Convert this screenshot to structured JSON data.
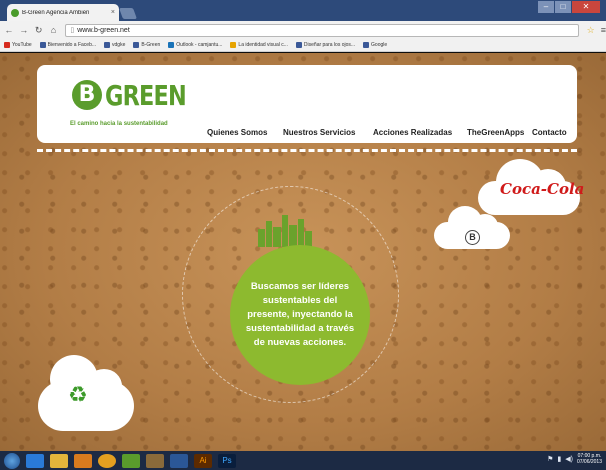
{
  "browser": {
    "tab_title": "B-Green Agencia Ambien",
    "tab_close": "×",
    "address": "www.b-green.net",
    "bookmarks": [
      {
        "label": "YouTube",
        "color": "#d62b1e"
      },
      {
        "label": "Bienvenido a Faceb...",
        "color": "#3b5998"
      },
      {
        "label": "vdgke",
        "color": "#3b5998"
      },
      {
        "label": "B-Green",
        "color": "#3b5998"
      },
      {
        "label": "Outlook - camjantu...",
        "color": "#1a73b8"
      },
      {
        "label": "La identidad visual c...",
        "color": "#e6a300"
      },
      {
        "label": "Diseñar para los ojos...",
        "color": "#3b5998"
      },
      {
        "label": "Google",
        "color": "#3b5998"
      }
    ]
  },
  "site": {
    "logo_letter": "B",
    "logo_word": "GREEN",
    "tagline": "El camino hacia la sustentabilidad",
    "nav": [
      "Quienes Somos",
      "Nuestros Servicios",
      "Acciones Realizadas",
      "TheGreenApps",
      "Contacto"
    ],
    "partner_logo": "Coca-Cola",
    "b_mark": "B",
    "mission": "Buscamos ser líderes sustentables del presente, inyectando la sustentabilidad a través de nuevas acciones.",
    "recycle_symbol": "♻"
  },
  "colors": {
    "brand_green": "#5a9c2c",
    "circle_green": "#8dba2f",
    "coke_red": "#d01a1a"
  },
  "taskbar": {
    "icons": [
      "start-icon",
      "ie-icon",
      "explorer-icon",
      "media-icon",
      "chrome-icon",
      "app-icon",
      "folder-icon",
      "word-icon",
      "illustrator-icon",
      "photoshop-icon"
    ],
    "time": "07:00 p.m.",
    "date": "07/06/2013"
  }
}
